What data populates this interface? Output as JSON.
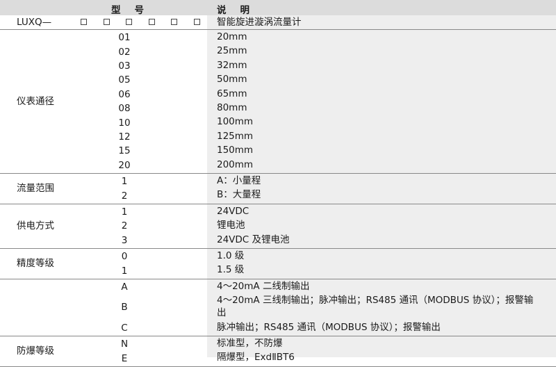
{
  "header": {
    "model": "型号",
    "description": "说明"
  },
  "product": {
    "code": "LUXQ—",
    "name": "智能旋进漩涡流量计",
    "box_count": 6
  },
  "groups": [
    {
      "label": "仪表通径",
      "rows": [
        {
          "code": "01",
          "desc": "20mm"
        },
        {
          "code": "02",
          "desc": "25mm"
        },
        {
          "code": "03",
          "desc": "32mm"
        },
        {
          "code": "05",
          "desc": "50mm"
        },
        {
          "code": "06",
          "desc": "65mm"
        },
        {
          "code": "08",
          "desc": "80mm"
        },
        {
          "code": "10",
          "desc": "100mm"
        },
        {
          "code": "12",
          "desc": "125mm"
        },
        {
          "code": "15",
          "desc": "150mm"
        },
        {
          "code": "20",
          "desc": "200mm"
        }
      ]
    },
    {
      "label": "流量范围",
      "rows": [
        {
          "code": "1",
          "desc": "A：小量程"
        },
        {
          "code": "2",
          "desc": "B：大量程"
        }
      ]
    },
    {
      "label": "供电方式",
      "rows": [
        {
          "code": "1",
          "desc": "24VDC"
        },
        {
          "code": "2",
          "desc": "锂电池"
        },
        {
          "code": "3",
          "desc": "24VDC 及锂电池"
        }
      ]
    },
    {
      "label": "精度等级",
      "rows": [
        {
          "code": "0",
          "desc": "1.0 级"
        },
        {
          "code": "1",
          "desc": "1.5 级"
        }
      ]
    },
    {
      "label": "",
      "rows": [
        {
          "code": "A",
          "desc": "4～20mA 二线制输出"
        },
        {
          "code": "B",
          "desc": "4～20mA 三线制输出；脉冲输出；RS485 通讯（MODBUS 协议）；报警输",
          "desc2": "出"
        },
        {
          "code": "C",
          "desc": "脉冲输出；RS485 通讯（MODBUS 协议）；报警输出"
        }
      ]
    },
    {
      "label": "防爆等级",
      "rows": [
        {
          "code": "N",
          "desc": "标准型，不防爆"
        },
        {
          "code": "E",
          "desc": "隔爆型，ExdⅡBT6"
        }
      ]
    }
  ]
}
